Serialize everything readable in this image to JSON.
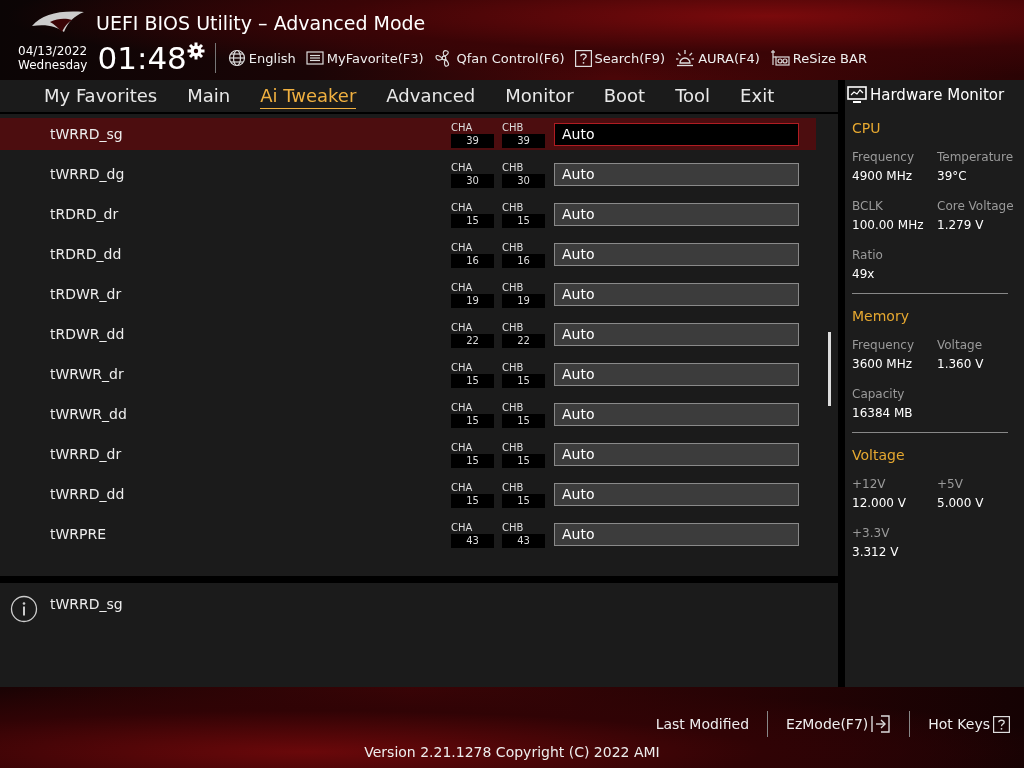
{
  "header": {
    "title": "UEFI BIOS Utility – Advanced Mode",
    "date": "04/13/2022",
    "weekday": "Wednesday",
    "time": "01:48",
    "tools": [
      {
        "label": "English"
      },
      {
        "label": "MyFavorite(F3)"
      },
      {
        "label": "Qfan Control(F6)"
      },
      {
        "label": "Search(F9)"
      },
      {
        "label": "AURA(F4)"
      },
      {
        "label": "ReSize BAR"
      }
    ]
  },
  "tabs": [
    {
      "label": "My Favorites",
      "selected": false
    },
    {
      "label": "Main",
      "selected": false
    },
    {
      "label": "Ai Tweaker",
      "selected": true
    },
    {
      "label": "Advanced",
      "selected": false
    },
    {
      "label": "Monitor",
      "selected": false
    },
    {
      "label": "Boot",
      "selected": false
    },
    {
      "label": "Tool",
      "selected": false
    },
    {
      "label": "Exit",
      "selected": false
    }
  ],
  "settings": [
    {
      "name": "tWRRD_sg",
      "channels": [
        {
          "label": "CHA",
          "value": "39"
        },
        {
          "label": "CHB",
          "value": "39"
        }
      ],
      "value": "Auto",
      "selected": true
    },
    {
      "name": "tWRRD_dg",
      "channels": [
        {
          "label": "CHA",
          "value": "30"
        },
        {
          "label": "CHB",
          "value": "30"
        }
      ],
      "value": "Auto",
      "selected": false
    },
    {
      "name": "tRDRD_dr",
      "channels": [
        {
          "label": "CHA",
          "value": "15"
        },
        {
          "label": "CHB",
          "value": "15"
        }
      ],
      "value": "Auto",
      "selected": false
    },
    {
      "name": "tRDRD_dd",
      "channels": [
        {
          "label": "CHA",
          "value": "16"
        },
        {
          "label": "CHB",
          "value": "16"
        }
      ],
      "value": "Auto",
      "selected": false
    },
    {
      "name": "tRDWR_dr",
      "channels": [
        {
          "label": "CHA",
          "value": "19"
        },
        {
          "label": "CHB",
          "value": "19"
        }
      ],
      "value": "Auto",
      "selected": false
    },
    {
      "name": "tRDWR_dd",
      "channels": [
        {
          "label": "CHA",
          "value": "22"
        },
        {
          "label": "CHB",
          "value": "22"
        }
      ],
      "value": "Auto",
      "selected": false
    },
    {
      "name": "tWRWR_dr",
      "channels": [
        {
          "label": "CHA",
          "value": "15"
        },
        {
          "label": "CHB",
          "value": "15"
        }
      ],
      "value": "Auto",
      "selected": false
    },
    {
      "name": "tWRWR_dd",
      "channels": [
        {
          "label": "CHA",
          "value": "15"
        },
        {
          "label": "CHB",
          "value": "15"
        }
      ],
      "value": "Auto",
      "selected": false
    },
    {
      "name": "tWRRD_dr",
      "channels": [
        {
          "label": "CHA",
          "value": "15"
        },
        {
          "label": "CHB",
          "value": "15"
        }
      ],
      "value": "Auto",
      "selected": false
    },
    {
      "name": "tWRRD_dd",
      "channels": [
        {
          "label": "CHA",
          "value": "15"
        },
        {
          "label": "CHB",
          "value": "15"
        }
      ],
      "value": "Auto",
      "selected": false
    },
    {
      "name": "tWRPRE",
      "channels": [
        {
          "label": "CHA",
          "value": "43"
        },
        {
          "label": "CHB",
          "value": "43"
        }
      ],
      "value": "Auto",
      "selected": false
    }
  ],
  "help": {
    "text": "tWRRD_sg"
  },
  "hardware_monitor": {
    "title": "Hardware Monitor",
    "sections": [
      {
        "title": "CPU",
        "items": [
          {
            "label": "Frequency",
            "value": "4900 MHz"
          },
          {
            "label": "Temperature",
            "value": "39°C"
          },
          {
            "label": "BCLK",
            "value": "100.00 MHz"
          },
          {
            "label": "Core Voltage",
            "value": "1.279 V"
          },
          {
            "label": "Ratio",
            "value": "49x"
          }
        ]
      },
      {
        "title": "Memory",
        "items": [
          {
            "label": "Frequency",
            "value": "3600 MHz"
          },
          {
            "label": "Voltage",
            "value": "1.360 V"
          },
          {
            "label": "Capacity",
            "value": "16384 MB"
          }
        ]
      },
      {
        "title": "Voltage",
        "items": [
          {
            "label": "+12V",
            "value": "12.000 V"
          },
          {
            "label": "+5V",
            "value": "5.000 V"
          },
          {
            "label": "+3.3V",
            "value": "3.312 V"
          }
        ]
      }
    ]
  },
  "footer": {
    "actions": [
      {
        "label": "Last Modified"
      },
      {
        "label": "EzMode(F7)"
      },
      {
        "label": "Hot Keys"
      }
    ],
    "version": "Version 2.21.1278 Copyright (C) 2022 AMI"
  }
}
